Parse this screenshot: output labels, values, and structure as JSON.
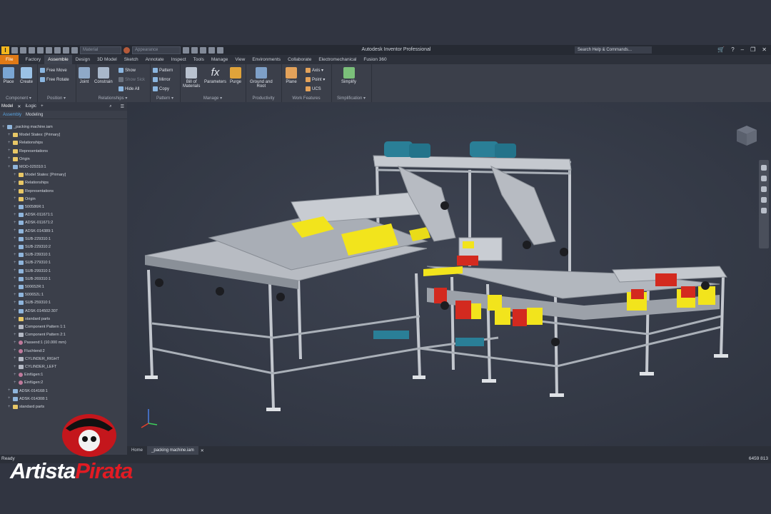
{
  "app_title": "Autodesk Inventor Professional",
  "search_placeholder": "Search Help & Commands...",
  "qat": {
    "material": "Material",
    "appearance": "Appearance"
  },
  "tabs": [
    "File",
    "Factory",
    "Assemble",
    "Design",
    "3D Model",
    "Sketch",
    "Annotate",
    "Inspect",
    "Tools",
    "Manage",
    "View",
    "Environments",
    "Collaborate",
    "Electromechanical",
    "Fusion 360"
  ],
  "active_tab": "Assemble",
  "ribbon": {
    "place": "Place",
    "create": "Create",
    "component_group": "Component ▾",
    "free_move": "Free Move",
    "free_rotate": "Free Rotate",
    "position_group": "Position ▾",
    "joint": "Joint",
    "constrain": "Constrain",
    "show": "Show",
    "show_sick": "Show Sick",
    "hide_all": "Hide All",
    "relationships_group": "Relationships ▾",
    "pattern": "Pattern",
    "mirror": "Mirror",
    "copy": "Copy",
    "pattern_group": "Pattern ▾",
    "bill_of": "Bill of",
    "materials": "Materials",
    "parameters": "Parameters",
    "purge": "Purge",
    "manage_group": "Manage ▾",
    "ground_and": "Ground and",
    "root": "Root",
    "productivity_group": "Productivity",
    "plane": "Plane",
    "axis": "Axis ▾",
    "point": "Point ▾",
    "ucs": "UCS",
    "work_features_group": "Work Features",
    "simplify": "Simplify",
    "simplification_group": "Simplification ▾"
  },
  "browser": {
    "tabs": [
      "Model",
      "iLogic"
    ],
    "subtabs": [
      "Assembly",
      "Modeling"
    ],
    "items": [
      {
        "label": "_packing machine.iam",
        "indent": 0,
        "icon": "part"
      },
      {
        "label": "Model States: [Primary]",
        "indent": 1,
        "icon": "folder"
      },
      {
        "label": "Relationships",
        "indent": 1,
        "icon": "folder"
      },
      {
        "label": "Representations",
        "indent": 1,
        "icon": "folder"
      },
      {
        "label": "Origin",
        "indent": 1,
        "icon": "folder"
      },
      {
        "label": "MOD-029310:1",
        "indent": 1,
        "icon": "part"
      },
      {
        "label": "Model States: [Primary]",
        "indent": 2,
        "icon": "folder"
      },
      {
        "label": "Relationships",
        "indent": 2,
        "icon": "folder"
      },
      {
        "label": "Representations",
        "indent": 2,
        "icon": "folder"
      },
      {
        "label": "Origin",
        "indent": 2,
        "icon": "folder"
      },
      {
        "label": "500586R:1",
        "indent": 2,
        "icon": "part"
      },
      {
        "label": "ADSK-011671:1",
        "indent": 2,
        "icon": "part"
      },
      {
        "label": "ADSK-011671:2",
        "indent": 2,
        "icon": "part"
      },
      {
        "label": "ADSK-014389:1",
        "indent": 2,
        "icon": "part"
      },
      {
        "label": "SUB-229310:1",
        "indent": 2,
        "icon": "part"
      },
      {
        "label": "SUB-229310:2",
        "indent": 2,
        "icon": "part"
      },
      {
        "label": "SUB-239310:1",
        "indent": 2,
        "icon": "part"
      },
      {
        "label": "SUB-279310:1",
        "indent": 2,
        "icon": "part"
      },
      {
        "label": "SUB-299310:1",
        "indent": 2,
        "icon": "part"
      },
      {
        "label": "SUB-269310:1",
        "indent": 2,
        "icon": "part"
      },
      {
        "label": "500652R:1",
        "indent": 2,
        "icon": "part"
      },
      {
        "label": "500652L:1",
        "indent": 2,
        "icon": "part"
      },
      {
        "label": "SUB-259310:1",
        "indent": 2,
        "icon": "part"
      },
      {
        "label": "ADSK-014502:307",
        "indent": 2,
        "icon": "part"
      },
      {
        "label": "standard parts",
        "indent": 2,
        "icon": "folder"
      },
      {
        "label": "Component Pattern 1:1",
        "indent": 2,
        "icon": "pattern"
      },
      {
        "label": "Component Pattern 2:1",
        "indent": 2,
        "icon": "pattern"
      },
      {
        "label": "Passend:1 (10.000 mm)",
        "indent": 2,
        "icon": "constraint"
      },
      {
        "label": "Fluchtend:2",
        "indent": 2,
        "icon": "constraint"
      },
      {
        "label": "CYLINDER_RIGHT",
        "indent": 2,
        "icon": "pattern"
      },
      {
        "label": "CYLINDER_LEFT",
        "indent": 2,
        "icon": "pattern"
      },
      {
        "label": "Einfügen:1",
        "indent": 2,
        "icon": "constraint"
      },
      {
        "label": "Einfügen:2",
        "indent": 2,
        "icon": "constraint"
      },
      {
        "label": "ADSK-014168:1",
        "indent": 1,
        "icon": "part"
      },
      {
        "label": "ADSK-014308:1",
        "indent": 1,
        "icon": "part"
      },
      {
        "label": "standard parts",
        "indent": 1,
        "icon": "folder"
      }
    ]
  },
  "doc_tabs": [
    "Home",
    "_packing machine.iam"
  ],
  "status": {
    "text": "Ready",
    "numbers": "6459   813"
  },
  "watermark": {
    "part1": "Artista",
    "part2": "Pirata"
  },
  "colors": {
    "accent_orange": "#e07a16",
    "frame_gray": "#b9bdc4",
    "part_yellow": "#f2e41c",
    "motor_teal": "#2a7f97",
    "part_red": "#d32a1f"
  }
}
